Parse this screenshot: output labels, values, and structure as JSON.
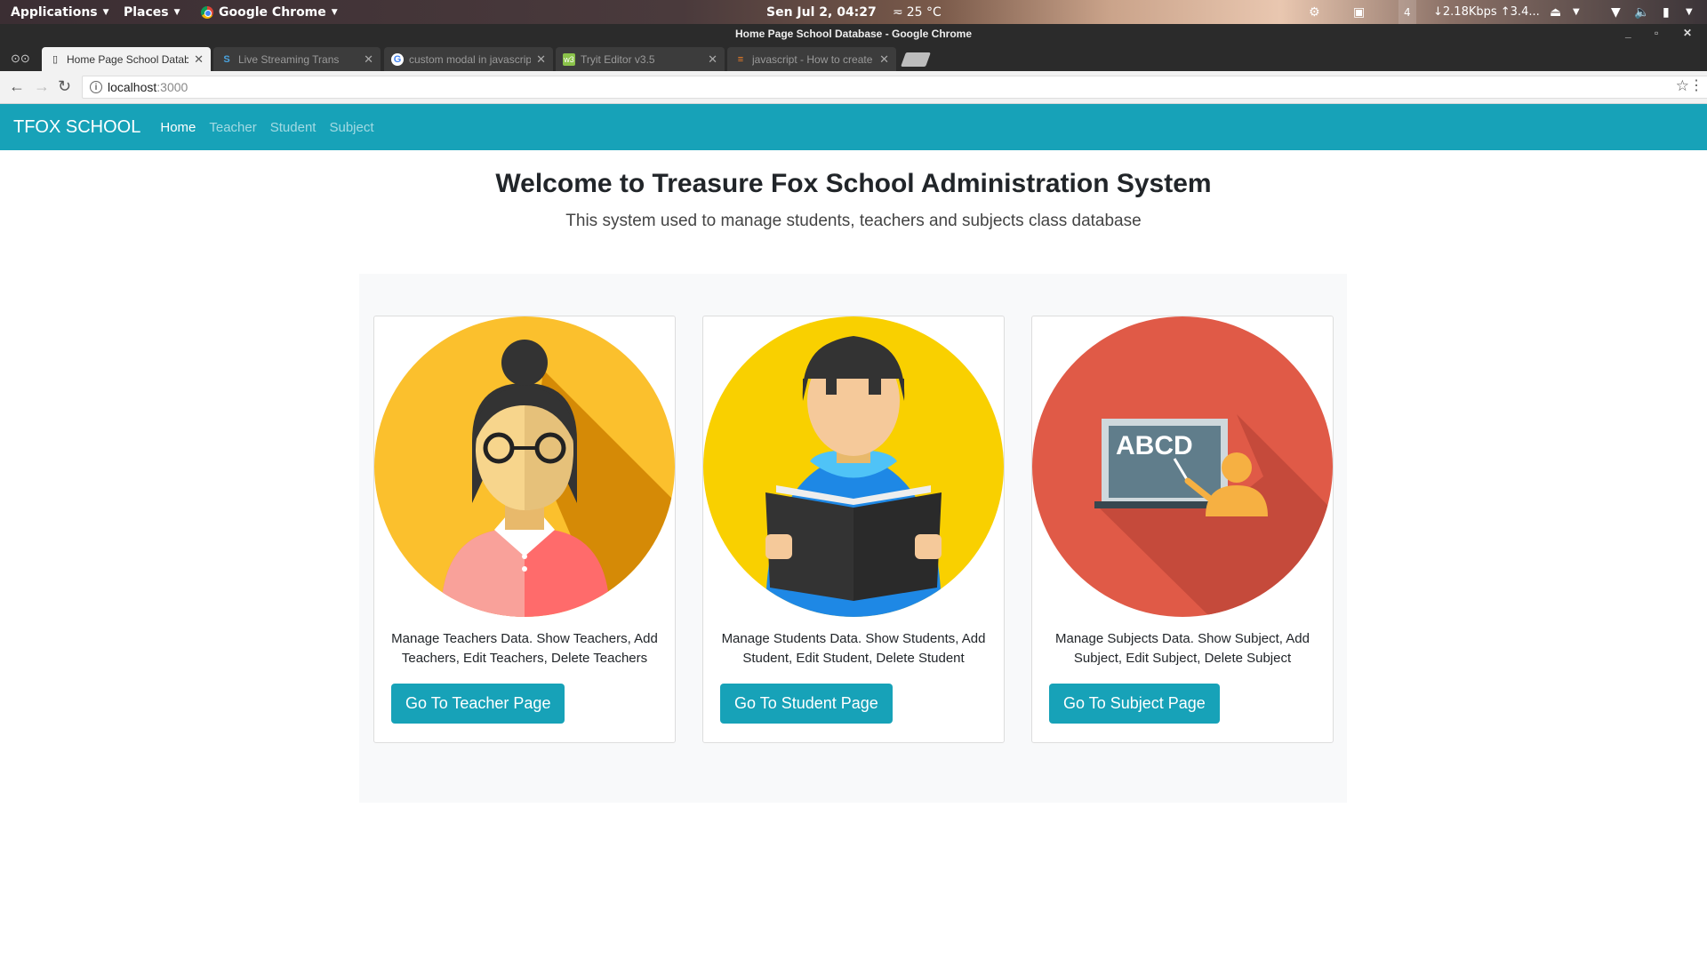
{
  "system_bar": {
    "applications": "Applications",
    "places": "Places",
    "active_app": "Google Chrome",
    "clock": "Sen Jul  2, 04:27",
    "temperature": "25 °C",
    "workspace": "4",
    "network_speed": "↓2.18Kbps ↑3.4..."
  },
  "browser": {
    "window_title": "Home Page School Database - Google Chrome",
    "tabs": [
      {
        "label": "Home Page School Database",
        "active": true,
        "favicon": "page-icon"
      },
      {
        "label": "Live Streaming Trans",
        "active": false,
        "favicon": "s-logo-icon"
      },
      {
        "label": "custom modal in javascript",
        "active": false,
        "favicon": "google-icon"
      },
      {
        "label": "Tryit Editor v3.5",
        "active": false,
        "favicon": "w3-icon"
      },
      {
        "label": "javascript - How to create",
        "active": false,
        "favicon": "stackoverflow-icon"
      }
    ],
    "address": {
      "host": "localhost",
      "port": ":3000"
    }
  },
  "navbar": {
    "brand": "TFOX SCHOOL",
    "links": [
      {
        "label": "Home",
        "active": true
      },
      {
        "label": "Teacher",
        "active": false
      },
      {
        "label": "Student",
        "active": false
      },
      {
        "label": "Subject",
        "active": false
      }
    ],
    "color": "#17a2b8"
  },
  "hero": {
    "title": "Welcome to Treasure Fox School Administration System",
    "subtitle": "This system used to manage students, teachers and subjects class database"
  },
  "cards": [
    {
      "image": "teacher-illustration",
      "description": "Manage Teachers Data. Show Teachers, Add Teachers, Edit Teachers, Delete Teachers",
      "button": "Go To Teacher Page"
    },
    {
      "image": "student-illustration",
      "description": "Manage Students Data. Show Students, Add Student, Edit Student, Delete Student",
      "button": "Go To Student Page"
    },
    {
      "image": "subject-illustration",
      "description": "Manage Subjects Data. Show Subject, Add Subject, Edit Subject, Delete Subject",
      "button": "Go To Subject Page",
      "board_text": "ABCD"
    }
  ]
}
